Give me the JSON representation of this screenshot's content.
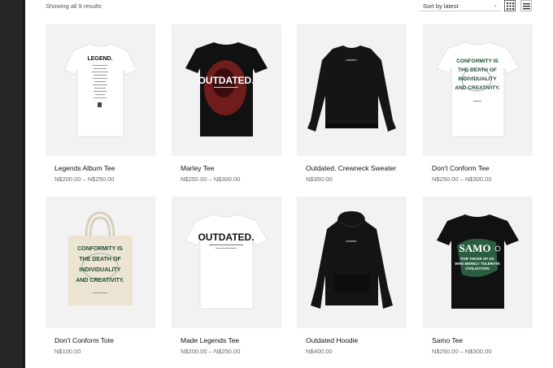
{
  "toolbar": {
    "result_count": "Showing all 9 results",
    "sort_value": "Sort by latest",
    "grid_view_icon": "grid-icon",
    "list_view_icon": "list-icon"
  },
  "products": [
    {
      "title": "Legends Album Tee",
      "price": "N$200.00 – N$250.00",
      "print": "LEGEND.",
      "garment": "white tee"
    },
    {
      "title": "Marley Tee",
      "price": "N$250.00 – N$300.00",
      "print": "OUTDATED.",
      "garment": "black tee"
    },
    {
      "title": "Outdated. Crewneck Sweater",
      "price": "N$350.00",
      "print": "outdated.",
      "garment": "black sweater"
    },
    {
      "title": "Don't Conform Tee",
      "price": "N$250.00 – N$300.00",
      "print": "CONFORMITY IS THE DEATH OF INDIVIDUALITY AND CREATIVITY.",
      "garment": "white tee"
    },
    {
      "title": "Don't Conform Tote",
      "price": "N$100.00",
      "print": "CONFORMITY IS THE DEATH OF INDIVIDUALITY AND CREATIVITY.",
      "garment": "tote bag"
    },
    {
      "title": "Made Legends Tee",
      "price": "N$200.00 – N$250.00",
      "print": "OUTDATED.",
      "garment": "white tee"
    },
    {
      "title": "Outdated Hoodie",
      "price": "N$400.00",
      "print": "outdated.",
      "garment": "black hoodie"
    },
    {
      "title": "Samo Tee",
      "price": "N$250.00 – N$300.00",
      "print": "SAMO© FOR THOSE OF US WHO MERELY TOLERATE CIVILIZATION",
      "garment": "black tee"
    }
  ]
}
